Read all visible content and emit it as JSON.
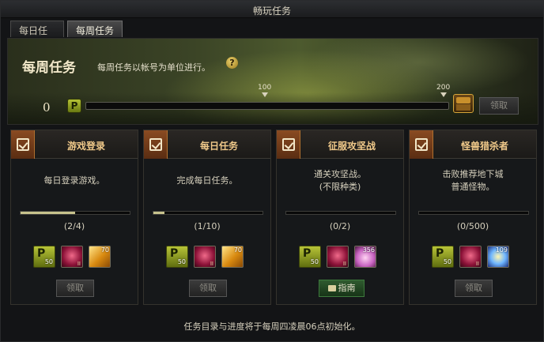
{
  "window": {
    "title": "畅玩任务"
  },
  "tabs": [
    {
      "label": "每日任务",
      "active": false
    },
    {
      "label": "每周任务",
      "active": true
    }
  ],
  "banner": {
    "title": "每周任务",
    "description": "每周任务以帐号为单位进行。",
    "help_icon": "question-icon",
    "points_current": "0",
    "point_badge": "P",
    "progress_fraction": 0,
    "milestone_100": "100",
    "milestone_200": "200",
    "claim_label": "领取"
  },
  "cards": [
    {
      "title": "游戏登录",
      "description": "每日登录游戏。",
      "progress_fraction": 0.5,
      "count": "(2/4)",
      "rewards": {
        "points": "50",
        "gem_tier": "II",
        "third_count": "70",
        "third_icon": "gold-box-icon"
      },
      "button": "领取"
    },
    {
      "title": "每日任务",
      "description": "完成每日任务。",
      "progress_fraction": 0.1,
      "count": "(1/10)",
      "rewards": {
        "points": "50",
        "gem_tier": "II",
        "third_count": "70",
        "third_icon": "gold-box-icon"
      },
      "button": "领取"
    },
    {
      "title": "征服攻坚战",
      "description": "通关攻坚战。\n(不限种类)",
      "progress_fraction": 0,
      "count": "(0/2)",
      "rewards": {
        "points": "50",
        "gem_tier": "II",
        "third_count": "356",
        "third_icon": "pink-crystal-icon"
      },
      "button": "指南"
    },
    {
      "title": "怪兽猎杀者",
      "description": "击败推荐地下城\n普通怪物。",
      "progress_fraction": 0,
      "count": "(0/500)",
      "rewards": {
        "points": "50",
        "gem_tier": "II",
        "third_count": "109",
        "third_icon": "star-gem-icon"
      },
      "button": "领取"
    }
  ],
  "footer": {
    "note": "任务目录与进度将于每周四凌晨06点初始化。"
  }
}
